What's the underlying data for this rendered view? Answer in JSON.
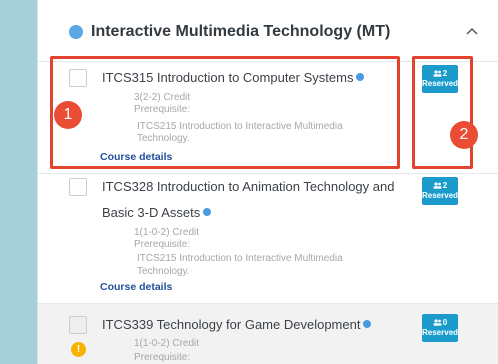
{
  "group": {
    "title": "Interactive Multimedia Technology (MT)",
    "icons": {
      "dot": "circle-icon",
      "collapse": "chevron-up-icon"
    }
  },
  "courses": [
    {
      "title": "ITCS315 Introduction to Computer Systems",
      "credit": "3(2-2) Credit",
      "prereq_label": "Prerequisite:",
      "prereq_line1": "ITCS215 Introduction to Interactive Multimedia",
      "prereq_line2": "Technology.",
      "details": "Course details",
      "badge_count": "2",
      "badge_label": "Reserved"
    },
    {
      "title_line1": "ITCS328 Introduction to Animation Technology and",
      "title_line2": "Basic 3-D Assets",
      "credit": "1(1-0-2) Credit",
      "prereq_label": "Prerequisite:",
      "prereq_line1": "ITCS215 Introduction to Interactive Multimedia",
      "prereq_line2": "Technology.",
      "details": "Course details",
      "badge_count": "2",
      "badge_label": "Reserved"
    },
    {
      "title": "ITCS339 Technology for Game Development",
      "credit": "1(1-0-2) Credit",
      "prereq_label": "Prerequisite:",
      "warning": "!",
      "badge_count": "0",
      "badge_label": "Reserved"
    }
  ],
  "annotations": {
    "marker1": "1",
    "marker2": "2"
  },
  "colors": {
    "accent": "#1b9bcc",
    "highlight": "#e1432f",
    "marker": "#ea4d34",
    "link": "#22519a",
    "warning": "#f5b400"
  }
}
